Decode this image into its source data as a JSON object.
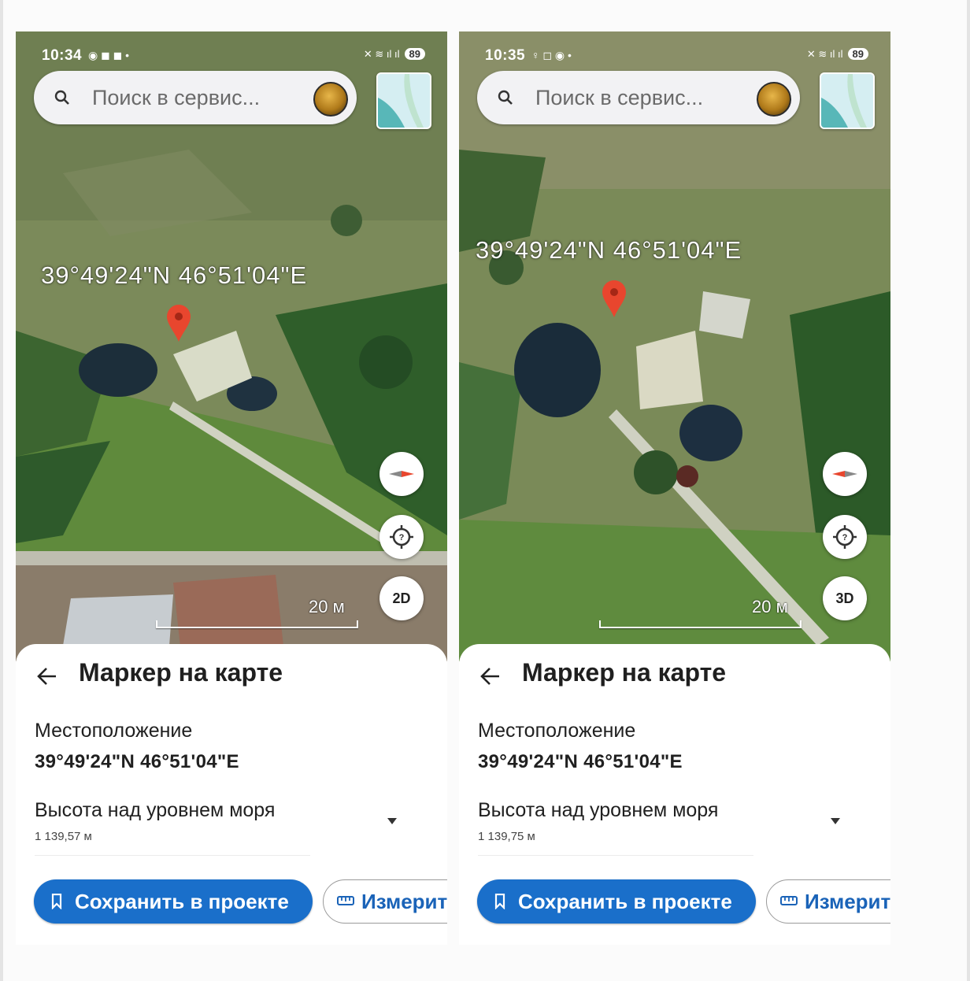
{
  "screens": [
    {
      "statusbar": {
        "time": "10:34",
        "battery": "89"
      },
      "search": {
        "placeholder": "Поиск в сервис..."
      },
      "map": {
        "coords_label": "39°49'24\"N 46°51'04\"E",
        "scale_label": "20 м",
        "view_mode": "2D",
        "icons": [
          "search-icon",
          "compass-icon",
          "locate-icon",
          "map-marker-icon",
          "layers-icon"
        ]
      },
      "sheet": {
        "title": "Маркер на карте",
        "location_label": "Местоположение",
        "location_value": "39°49'24\"N 46°51'04\"E",
        "altitude_label": "Высота над уровнем моря",
        "altitude_value": "1 139,57 м",
        "save_label": "Сохранить в проекте",
        "measure_label": "Измерит"
      }
    },
    {
      "statusbar": {
        "time": "10:35",
        "battery": "89"
      },
      "search": {
        "placeholder": "Поиск в сервис..."
      },
      "map": {
        "coords_label": "39°49'24\"N 46°51'04\"E",
        "scale_label": "20 м",
        "view_mode": "3D",
        "icons": [
          "search-icon",
          "compass-icon",
          "locate-icon",
          "map-marker-icon",
          "layers-icon"
        ]
      },
      "sheet": {
        "title": "Маркер на карте",
        "location_label": "Местоположение",
        "location_value": "39°49'24\"N 46°51'04\"E",
        "altitude_label": "Высота над уровнем моря",
        "altitude_value": "1 139,75 м",
        "save_label": "Сохранить в проекте",
        "measure_label": "Измерит"
      }
    }
  ],
  "colors": {
    "primary_button": "#1a6fca",
    "marker": "#e8462e",
    "map_grass": "#6e8a4a",
    "map_trees": "#2f5a2c"
  }
}
